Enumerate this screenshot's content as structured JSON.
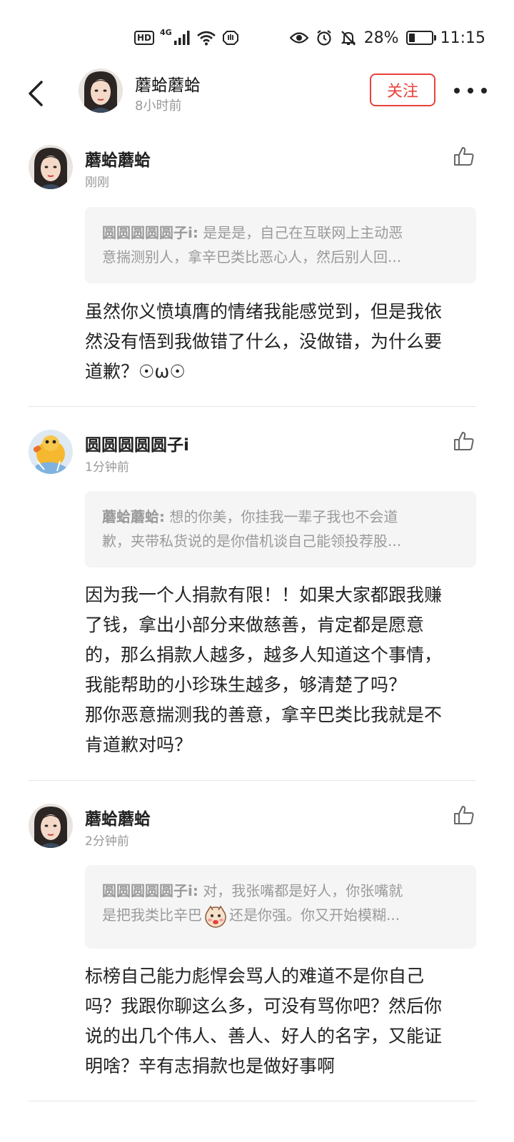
{
  "status_bar": {
    "left": {
      "hd": "HD",
      "network": "4G"
    },
    "right": {
      "battery_percent": "28%",
      "battery_level": 0.28,
      "time": "11:15"
    },
    "icons": [
      "signal-icon",
      "wifi-icon",
      "hand-icon",
      "eye-icon",
      "alarm-icon",
      "bell-off-icon",
      "battery-icon"
    ]
  },
  "header": {
    "author_name": "蘑蛤蘑蛤",
    "post_time": "8小时前",
    "follow_label": "关注"
  },
  "comments": [
    {
      "author": "蘑蛤蘑蛤",
      "time": "刚刚",
      "quote_name": "圆圆圆圆圆子i:",
      "quote_line1": " 是是是，自己在互联网上主动恶",
      "quote_line2": "意揣测别人，拿辛巴类比恶心人，然后别人回...",
      "body_lines": [
        "虽然你义愤填膺的情绪我能感觉到，但是我依",
        "然没有悟到我做错了什么，没做错，为什么要",
        "道歉？☉ω☉"
      ]
    },
    {
      "author": "圆圆圆圆圆子i",
      "time": "1分钟前",
      "quote_name": "蘑蛤蘑蛤:",
      "quote_line1": " 想的你美，你挂我一辈子我也不会道",
      "quote_line2": "歉，夹带私货说的是你借机谈自己能领投荐股...",
      "body_lines": [
        "因为我一个人捐款有限！！如果大家都跟我赚",
        "了钱，拿出小部分来做慈善，肯定都是愿意",
        "的，那么捐款人越多，越多人知道这个事情，",
        "我能帮助的小珍珠生越多，够清楚了吗？",
        "那你恶意揣测我的善意，拿辛巴类比我就是不",
        "肯道歉对吗？"
      ]
    },
    {
      "author": "蘑蛤蘑蛤",
      "time": "2分钟前",
      "quote_name": "圆圆圆圆圆子i:",
      "quote_line1": " 对，我张嘴都是好人，你张嘴就",
      "quote_line2_a": "是把我类比辛巴",
      "quote_line2_b": "还是你强。你又开始模糊...",
      "body_lines": [
        "标榜自己能力彪悍会骂人的难道不是你自己",
        "吗？我跟你聊这么多，可没有骂你吧？然后你",
        "说的出几个伟人、善人、好人的名字，又能证",
        "明啥？辛有志捐款也是做好事啊"
      ]
    }
  ]
}
